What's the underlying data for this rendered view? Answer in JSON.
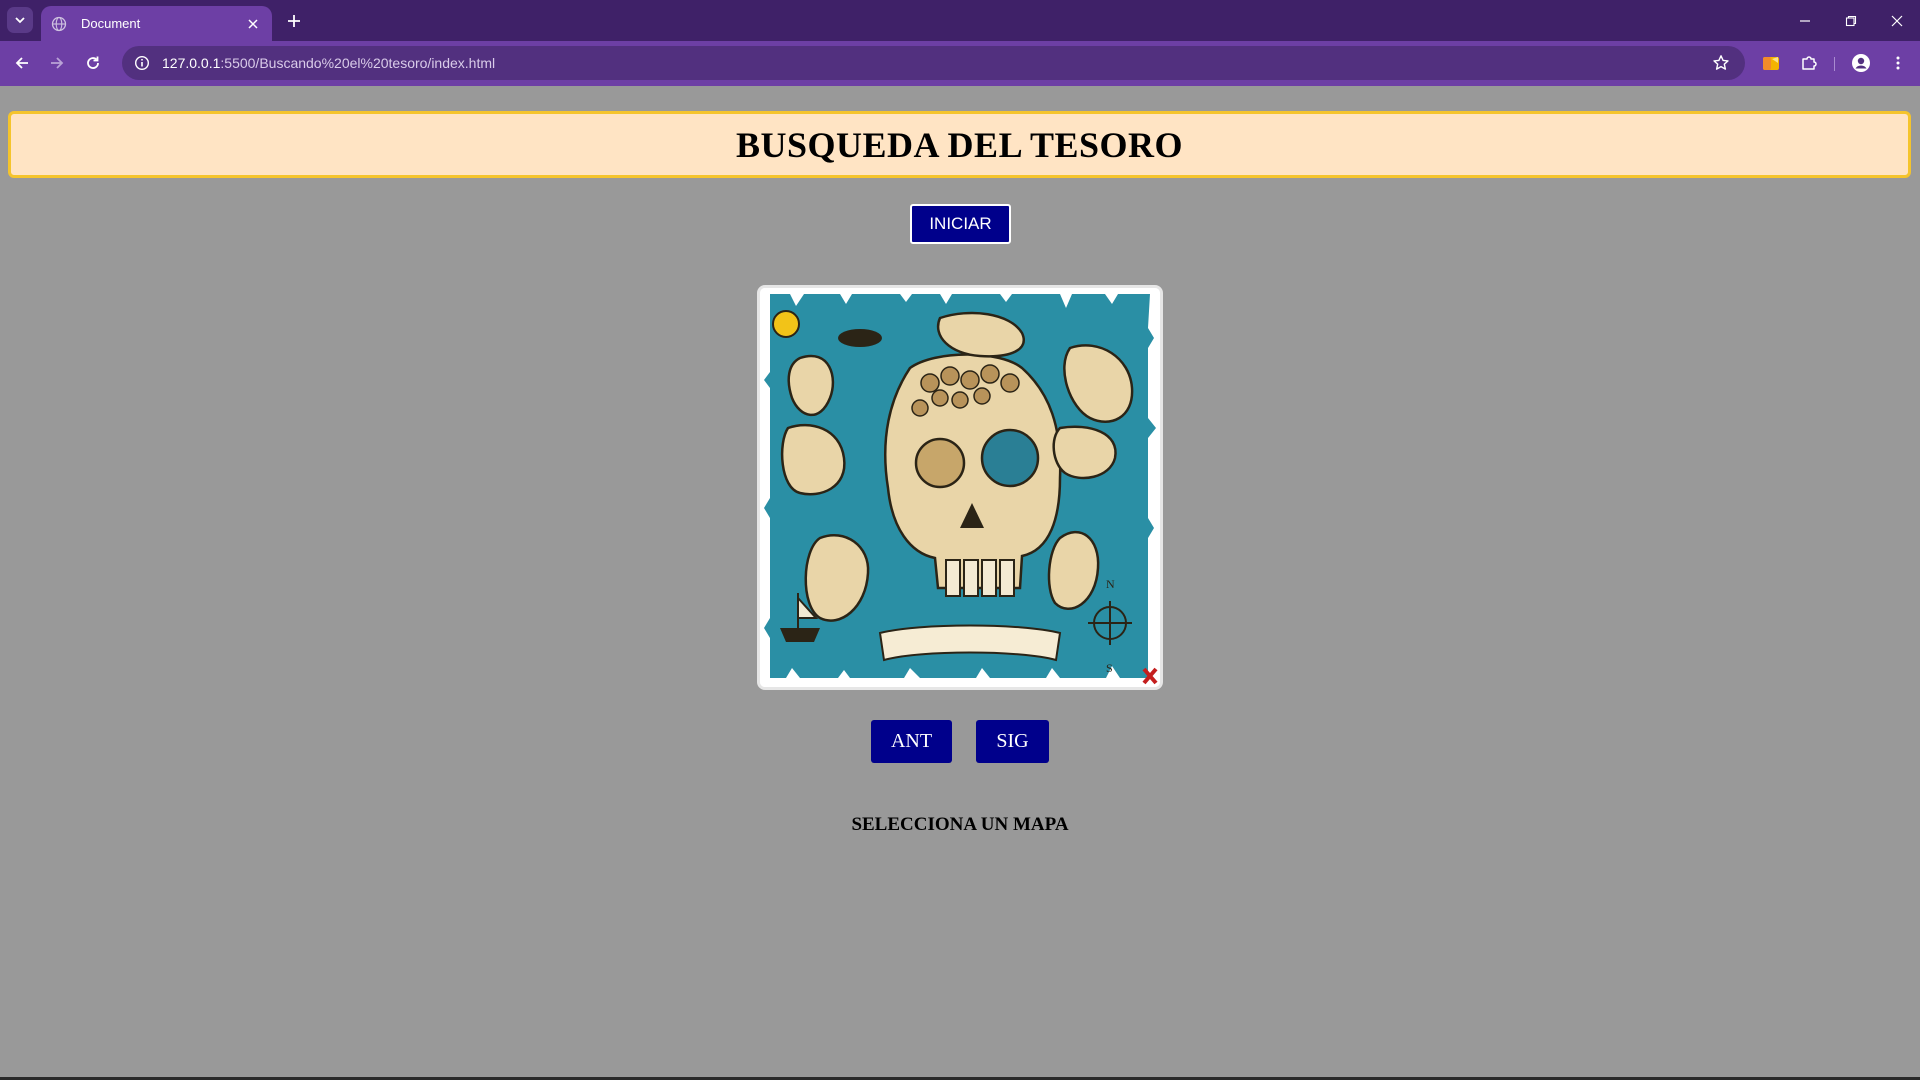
{
  "browser": {
    "tab_title": "Document",
    "url_host": "127.0.0.1",
    "url_rest": ":5500/Buscando%20el%20tesoro/index.html",
    "chrome_color": "#6d3fa5",
    "tabstrip_color": "#3f2168"
  },
  "page": {
    "title": "BUSQUEDA DEL TESORO",
    "start_button": "INICIAR",
    "prev_button": "ANT",
    "next_button": "SIG",
    "status_text": "SELECCIONA UN MAPA",
    "map_image_alt": "treasure-map",
    "background_color": "#999999",
    "header_background": "#ffe4c4",
    "header_border": "#f5c42c",
    "button_color": "#00008b"
  },
  "icons": {
    "tab_search": "chevron-down-icon",
    "favicon": "globe-icon",
    "tab_close": "close-icon",
    "new_tab": "plus-icon",
    "back": "arrow-left-icon",
    "forward": "arrow-right-icon",
    "reload": "reload-icon",
    "site_info": "info-icon",
    "bookmark": "star-icon",
    "extension_1": "colorful-extension-icon",
    "extensions": "puzzle-icon",
    "profile": "person-icon",
    "menu": "kebab-menu-icon",
    "minimize": "minimize-icon",
    "restore": "restore-icon",
    "close_window": "close-icon"
  }
}
